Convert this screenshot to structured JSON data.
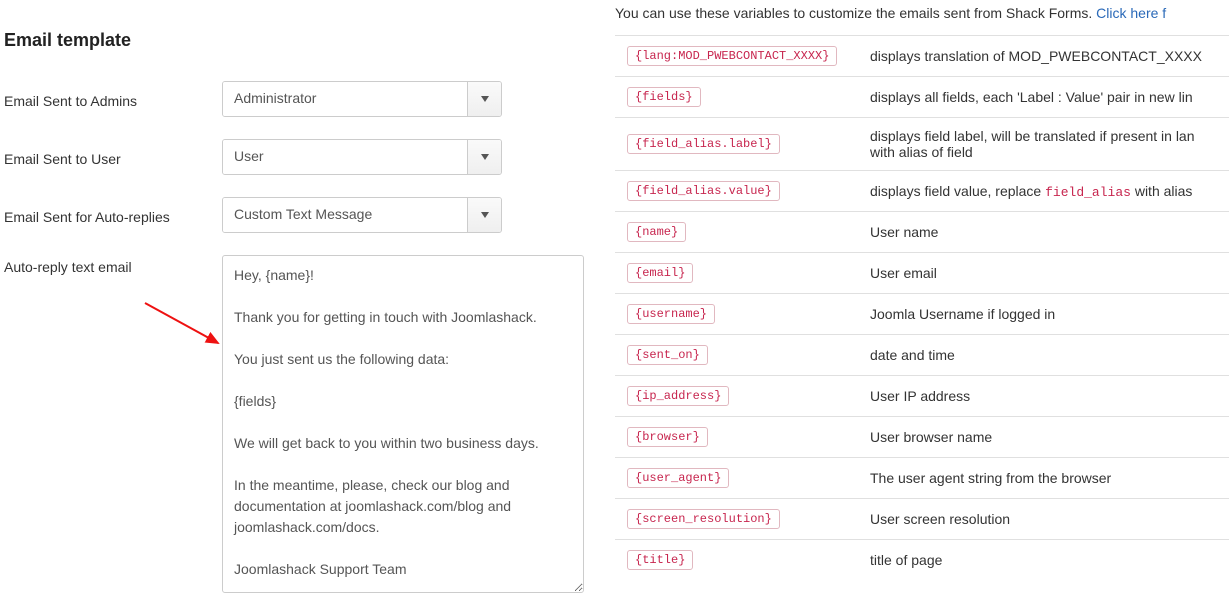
{
  "section": {
    "title": "Email template"
  },
  "labels": {
    "admins": "Email Sent to Admins",
    "user": "Email Sent to User",
    "autoreplies": "Email Sent for Auto-replies",
    "autoreply_text": "Auto-reply text email"
  },
  "selects": {
    "admins": "Administrator",
    "user": "User",
    "autoreplies": "Custom Text Message"
  },
  "textarea": {
    "value": "Hey, {name}!\n\nThank you for getting in touch with Joomlashack.\n\nYou just sent us the following data:\n\n{fields}\n\nWe will get back to you within two business days.\n\nIn the meantime, please, check our blog and documentation at joomlashack.com/blog and joomlashack.com/docs.\n\nJoomlashack Support Team"
  },
  "intro": {
    "prefix": "You can use these variables to customize the emails sent from Shack Forms. ",
    "link": "Click here f"
  },
  "vars": [
    {
      "code": "{lang:MOD_PWEBCONTACT_XXXX}",
      "desc": "displays translation of MOD_PWEBCONTACT_XXXX"
    },
    {
      "code": "{fields}",
      "desc": "displays all fields, each 'Label : Value' pair in new lin"
    },
    {
      "code": "{field_alias.label}",
      "desc_html": "displays field label, will be translated if present in lan with alias of field"
    },
    {
      "code": "{field_alias.value}",
      "desc_html": "displays field value, replace <code class=\"inline\">field_alias</code> with alias"
    },
    {
      "code": "{name}",
      "desc": "User name"
    },
    {
      "code": "{email}",
      "desc": "User email"
    },
    {
      "code": "{username}",
      "desc": "Joomla Username if logged in"
    },
    {
      "code": "{sent_on}",
      "desc": "date and time"
    },
    {
      "code": "{ip_address}",
      "desc": "User IP address"
    },
    {
      "code": "{browser}",
      "desc": "User browser name"
    },
    {
      "code": "{user_agent}",
      "desc": "The user agent string from the browser"
    },
    {
      "code": "{screen_resolution}",
      "desc": "User screen resolution"
    },
    {
      "code": "{title}",
      "desc": "title of page"
    }
  ]
}
